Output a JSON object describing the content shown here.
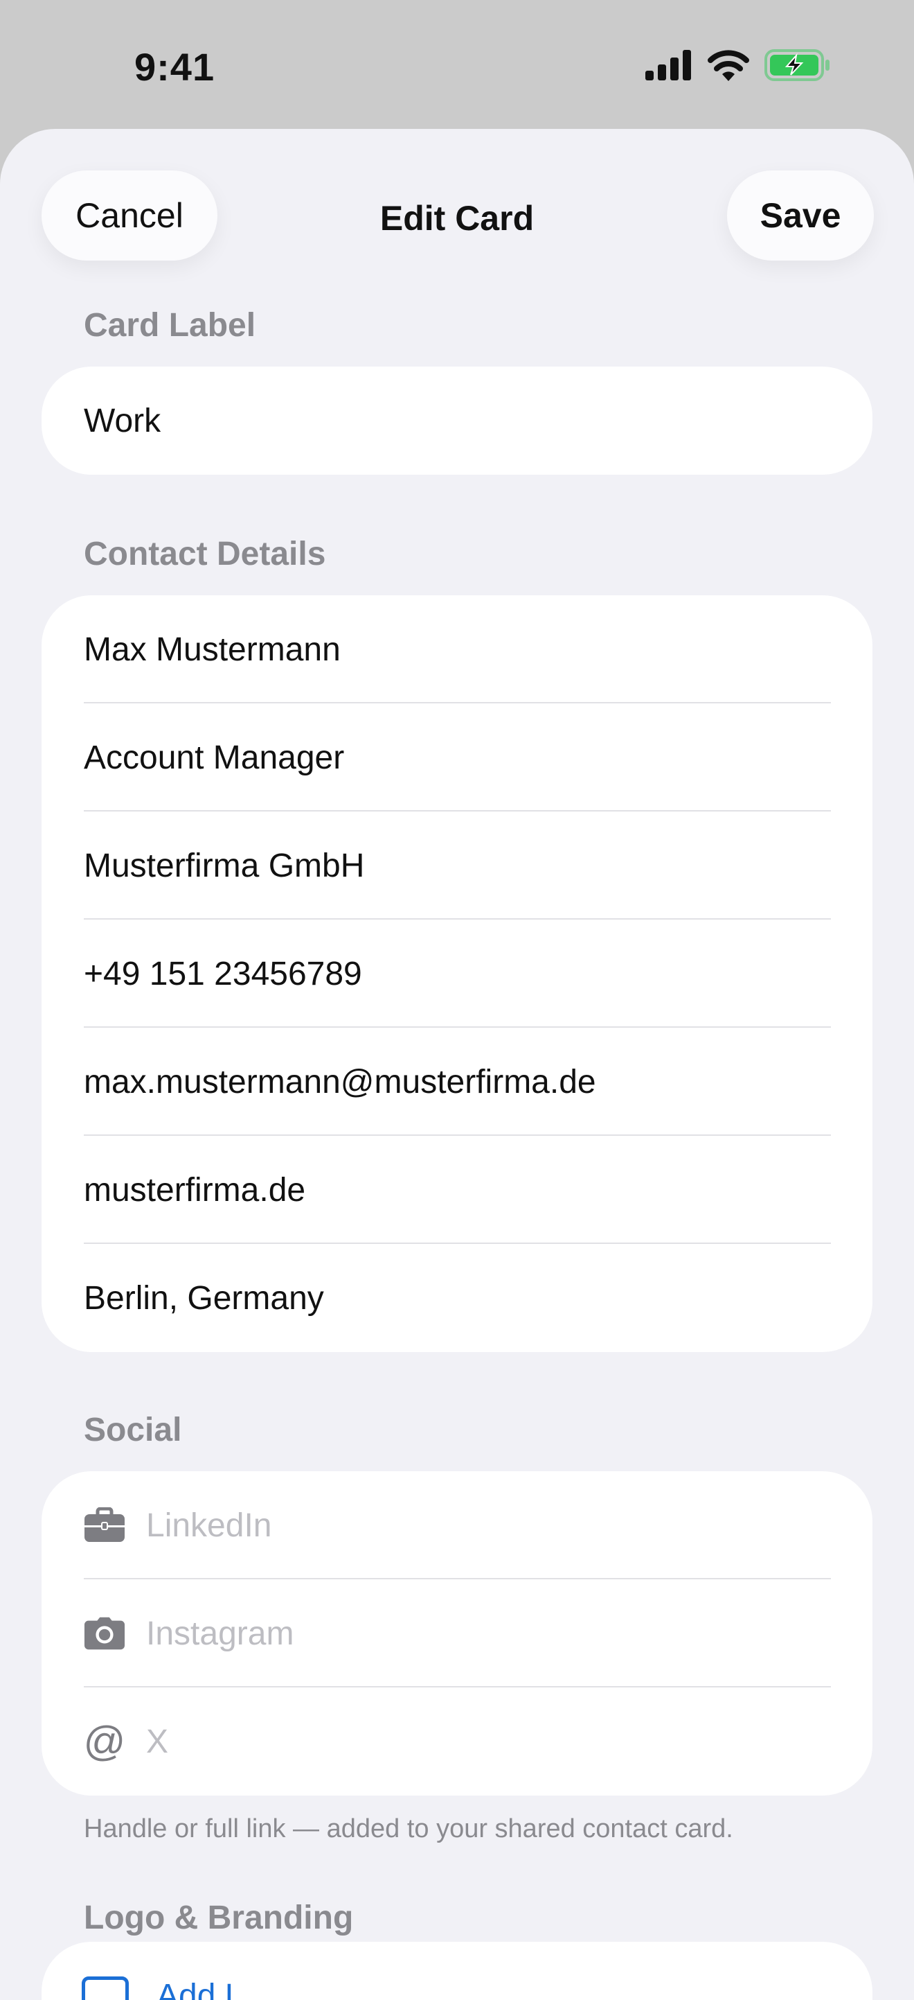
{
  "status_bar": {
    "time": "9:41",
    "signal_icon": "cellular-signal-icon",
    "wifi_icon": "wifi-icon",
    "battery_icon": "battery-charging-icon",
    "battery_color": "#34c759"
  },
  "nav": {
    "cancel_label": "Cancel",
    "title": "Edit Card",
    "save_label": "Save"
  },
  "card_label": {
    "header": "Card Label",
    "value": "Work"
  },
  "contact_details": {
    "header": "Contact Details",
    "fields": [
      {
        "value": "Max Mustermann"
      },
      {
        "value": "Account Manager"
      },
      {
        "value": "Musterfirma GmbH"
      },
      {
        "value": "+49 151 23456789"
      },
      {
        "value": "max.mustermann@musterfirma.de"
      },
      {
        "value": "musterfirma.de"
      },
      {
        "value": "Berlin, Germany"
      }
    ]
  },
  "social": {
    "header": "Social",
    "fields": [
      {
        "icon": "briefcase-icon",
        "placeholder": "LinkedIn"
      },
      {
        "icon": "camera-icon",
        "placeholder": "Instagram"
      },
      {
        "icon": "at-sign-icon",
        "icon_glyph": "@",
        "placeholder": "X"
      }
    ],
    "footnote": "Handle or full link — added to your shared contact card."
  },
  "branding": {
    "header": "Logo & Branding",
    "add_label": "Add L",
    "accent_color": "#1b6fd6"
  }
}
